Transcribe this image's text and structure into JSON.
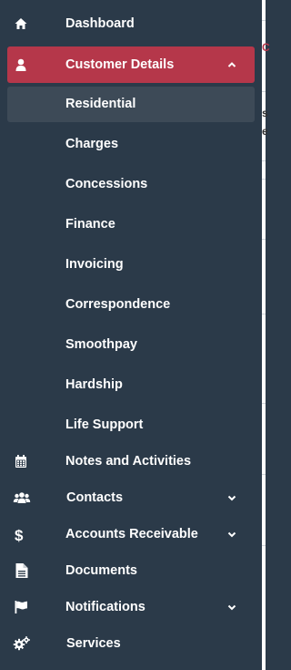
{
  "nav": {
    "dashboard": "Dashboard",
    "customer_details": "Customer Details",
    "sub_items": [
      "Residential",
      "Charges",
      "Concessions",
      "Finance",
      "Invoicing",
      "Correspondence",
      "Smoothpay",
      "Hardship",
      "Life Support"
    ],
    "notes": "Notes and Activities",
    "contacts": "Contacts",
    "accounts_receivable": "Accounts Receivable",
    "documents": "Documents",
    "notifications": "Notifications",
    "services": "Services"
  },
  "colors": {
    "sidebar_bg": "#2b3a49",
    "active_bg": "#b5374a",
    "selected_sub_bg": "#3d4a57",
    "text": "#ffffff"
  },
  "icons": {
    "dashboard": "home-icon",
    "customer_details": "user-icon",
    "notes": "calendar-icon",
    "contacts": "users-icon",
    "accounts_receivable": "dollar-icon",
    "documents": "document-icon",
    "notifications": "flag-icon",
    "services": "gears-icon"
  }
}
